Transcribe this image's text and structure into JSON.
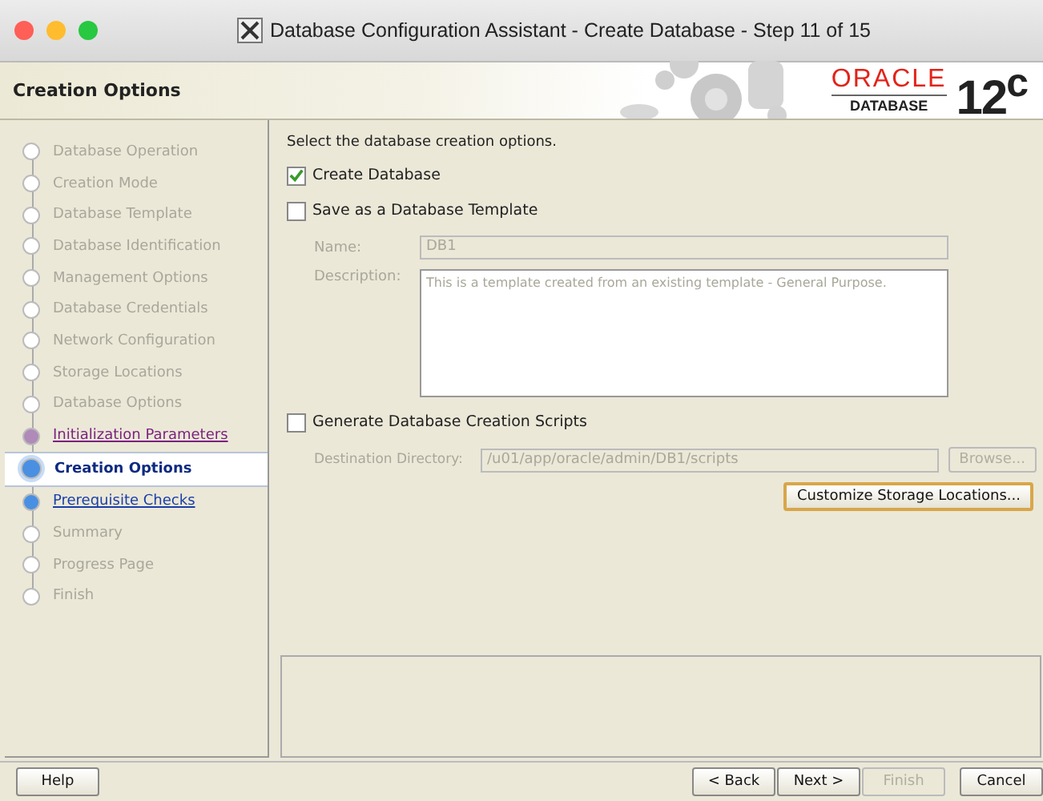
{
  "window": {
    "title": "Database Configuration Assistant - Create Database - Step 11 of 15"
  },
  "header": {
    "title": "Creation Options",
    "logo_brand": "ORACLE",
    "logo_product": "DATABASE",
    "logo_version": "12$^{c}$"
  },
  "steps": [
    {
      "label": "Database Operation",
      "disabled": true,
      "visited": false,
      "selected": false
    },
    {
      "label": "Creation Mode",
      "disabled": true,
      "visited": false,
      "selected": false
    },
    {
      "label": "Database Template",
      "disabled": true,
      "visited": false,
      "selected": false
    },
    {
      "label": "Database Identification",
      "disabled": true,
      "visited": false,
      "selected": false
    },
    {
      "label": "Management Options",
      "disabled": true,
      "visited": false,
      "selected": false
    },
    {
      "label": "Database Credentials",
      "disabled": true,
      "visited": false,
      "selected": false
    },
    {
      "label": "Network Configuration",
      "disabled": true,
      "visited": false,
      "selected": false
    },
    {
      "label": "Storage Locations",
      "disabled": true,
      "visited": false,
      "selected": false
    },
    {
      "label": "Database Options",
      "disabled": true,
      "visited": false,
      "selected": false
    },
    {
      "label": "Initialization Parameters",
      "disabled": false,
      "visited": true,
      "selected": false
    },
    {
      "label": "Creation Options",
      "disabled": false,
      "visited": false,
      "selected": true
    },
    {
      "label": "Prerequisite Checks",
      "disabled": false,
      "visited": false,
      "selected": false
    },
    {
      "label": "Summary",
      "disabled": true,
      "visited": false,
      "selected": false
    },
    {
      "label": "Progress Page",
      "disabled": true,
      "visited": false,
      "selected": false
    },
    {
      "label": "Finish",
      "disabled": true,
      "visited": false,
      "selected": false
    }
  ],
  "content": {
    "intro": "Select the database creation options.",
    "create_database": {
      "label": "Create Database",
      "checked": true
    },
    "save_template": {
      "label": "Save as a Database Template",
      "checked": false
    },
    "name": {
      "label": "Name:",
      "value": "DB1",
      "disabled": true
    },
    "description": {
      "label": "Description:",
      "value": "This is a template created from an existing template - General Purpose.",
      "disabled": true
    },
    "generate_scripts": {
      "label": "Generate Database Creation Scripts",
      "checked": false
    },
    "destination": {
      "label": "Destination Directory:",
      "value": "/u01/app/oracle/admin/DB1/scripts",
      "disabled": true
    },
    "browse": {
      "label": "Browse...",
      "disabled": true
    },
    "customize": {
      "label": "Customize Storage Locations..."
    }
  },
  "help_button": {
    "label": "Help"
  },
  "buttons": [
    {
      "label": "< Back",
      "disabled": false
    },
    {
      "label": "Next >",
      "disabled": false
    },
    {
      "label": "Finish",
      "disabled": true
    },
    {
      "label": "Cancel",
      "disabled": false
    }
  ]
}
